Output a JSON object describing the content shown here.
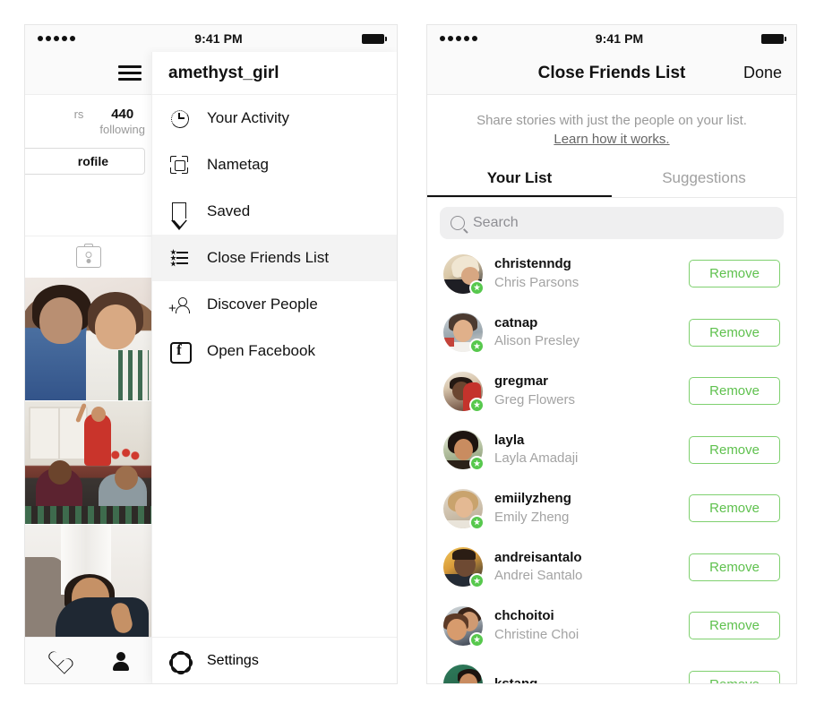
{
  "left_phone": {
    "status_bar": {
      "signal_dots": 5,
      "time": "9:41 PM",
      "battery": "full"
    },
    "profile": {
      "stats": [
        {
          "num": "",
          "label": "rs"
        },
        {
          "num": "440",
          "label": "following"
        }
      ],
      "edit_button": "rofile",
      "tabbar": [
        "heart-icon",
        "person-icon"
      ]
    },
    "menu": {
      "title": "amethyst_girl",
      "items": [
        {
          "icon": "activity-clock-icon",
          "label": "Your Activity",
          "active": false
        },
        {
          "icon": "nametag-icon",
          "label": "Nametag",
          "active": false
        },
        {
          "icon": "bookmark-icon",
          "label": "Saved",
          "active": false
        },
        {
          "icon": "close-friends-list-icon",
          "label": "Close Friends List",
          "active": true
        },
        {
          "icon": "add-person-icon",
          "label": "Discover People",
          "active": false
        },
        {
          "icon": "facebook-icon",
          "label": "Open Facebook",
          "active": false
        }
      ],
      "footer": {
        "icon": "gear-icon",
        "label": "Settings"
      }
    }
  },
  "right_phone": {
    "status_bar": {
      "signal_dots": 5,
      "time": "9:41 PM",
      "battery": "full"
    },
    "nav": {
      "title": "Close Friends List",
      "done_label": "Done"
    },
    "info": {
      "text": "Share stories with just the people on your list.",
      "link": "Learn how it works."
    },
    "tabs": [
      {
        "label": "Your List",
        "selected": true
      },
      {
        "label": "Suggestions",
        "selected": false
      }
    ],
    "search": {
      "placeholder": "Search",
      "value": "",
      "icon": "search-icon"
    },
    "friends": [
      {
        "username": "christenndg",
        "fullname": "Chris Parsons",
        "action": "Remove",
        "badge": "close-friend-star"
      },
      {
        "username": "catnap",
        "fullname": "Alison Presley",
        "action": "Remove",
        "badge": "close-friend-star"
      },
      {
        "username": "gregmar",
        "fullname": "Greg Flowers",
        "action": "Remove",
        "badge": "close-friend-star"
      },
      {
        "username": "layla",
        "fullname": "Layla Amadaji",
        "action": "Remove",
        "badge": "close-friend-star"
      },
      {
        "username": "emiilyzheng",
        "fullname": "Emily Zheng",
        "action": "Remove",
        "badge": "close-friend-star"
      },
      {
        "username": "andreisantalo",
        "fullname": "Andrei Santalo",
        "action": "Remove",
        "badge": "close-friend-star"
      },
      {
        "username": "chchoitoi",
        "fullname": "Christine Choi",
        "action": "Remove",
        "badge": "close-friend-star"
      },
      {
        "username": "kstang",
        "fullname": "",
        "action": "Remove",
        "badge": "close-friend-star"
      }
    ]
  },
  "colors": {
    "accent_green": "#57c84d",
    "remove_text": "#5fc14e",
    "remove_border": "#7fd06f",
    "text_primary": "#111111",
    "text_secondary": "#a3a3a3",
    "bg": "#ffffff",
    "chrome": "#fafafa"
  }
}
